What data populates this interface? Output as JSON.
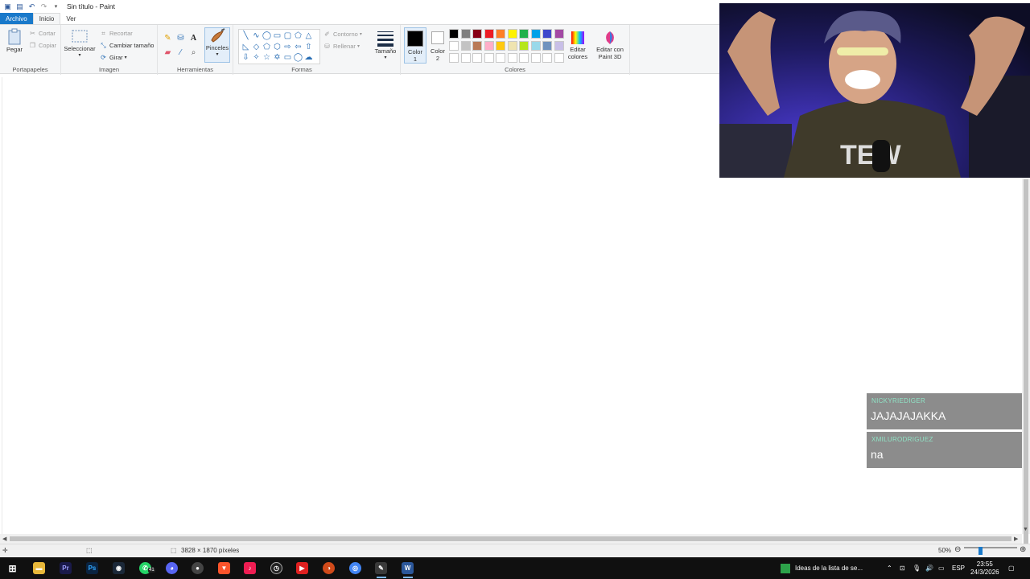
{
  "window": {
    "title": "Sin título - Paint"
  },
  "quick_access": [
    "save-icon",
    "undo-icon",
    "redo-icon",
    "dropdown-icon"
  ],
  "tabs": [
    {
      "label": "Archivo"
    },
    {
      "label": "Inicio"
    },
    {
      "label": "Ver"
    }
  ],
  "ribbon": {
    "clipboard": {
      "paste": "Pegar",
      "cut": "Cortar",
      "copy": "Copiar",
      "group": "Portapapeles"
    },
    "image": {
      "select": "Seleccionar",
      "crop": "Recortar",
      "resize": "Cambiar tamaño",
      "rotate": "Girar",
      "group": "Imagen"
    },
    "tools": {
      "brushes": "Pinceles",
      "group": "Herramientas"
    },
    "shapes": {
      "outline": "Contorno",
      "fill": "Rellenar",
      "group": "Formas"
    },
    "size": "Tamaño",
    "colors": {
      "color1": "Color 1",
      "color2": "Color 2",
      "edit": "Editar colores",
      "paint3d": "Editar con Paint 3D",
      "group": "Colores",
      "color1_value": "#000000",
      "color2_value": "#ffffff",
      "palette_row1": [
        "#000000",
        "#7f7f7f",
        "#880015",
        "#ed1c24",
        "#ff7f27",
        "#fff200",
        "#22b14c",
        "#00a2e8",
        "#3f48cc",
        "#a349a4"
      ],
      "palette_row2": [
        "#ffffff",
        "#c3c3c3",
        "#b97a57",
        "#ffaec9",
        "#ffc90e",
        "#efe4b0",
        "#b5e61d",
        "#99d9ea",
        "#7092be",
        "#c8bfe7"
      ],
      "palette_row3": [
        "#ffffff",
        "#ffffff",
        "#ffffff",
        "#ffffff",
        "#ffffff",
        "#ffffff",
        "#ffffff",
        "#ffffff",
        "#ffffff",
        "#ffffff"
      ]
    }
  },
  "status": {
    "dimensions": "3828 × 1870 píxeles",
    "zoom": "50%",
    "zoom_fraction": 0.5
  },
  "taskbar": {
    "notification": "Ideas de la lista de se...",
    "language": "ESP",
    "time": "23:55",
    "date": "24/3/2026",
    "whatsapp_badge": "41"
  },
  "chat": [
    {
      "user": "NICKYRIEDIGER",
      "message": "JAJAJAJAKKA"
    },
    {
      "user": "XMILURODRIGUEZ",
      "message": "na"
    }
  ]
}
